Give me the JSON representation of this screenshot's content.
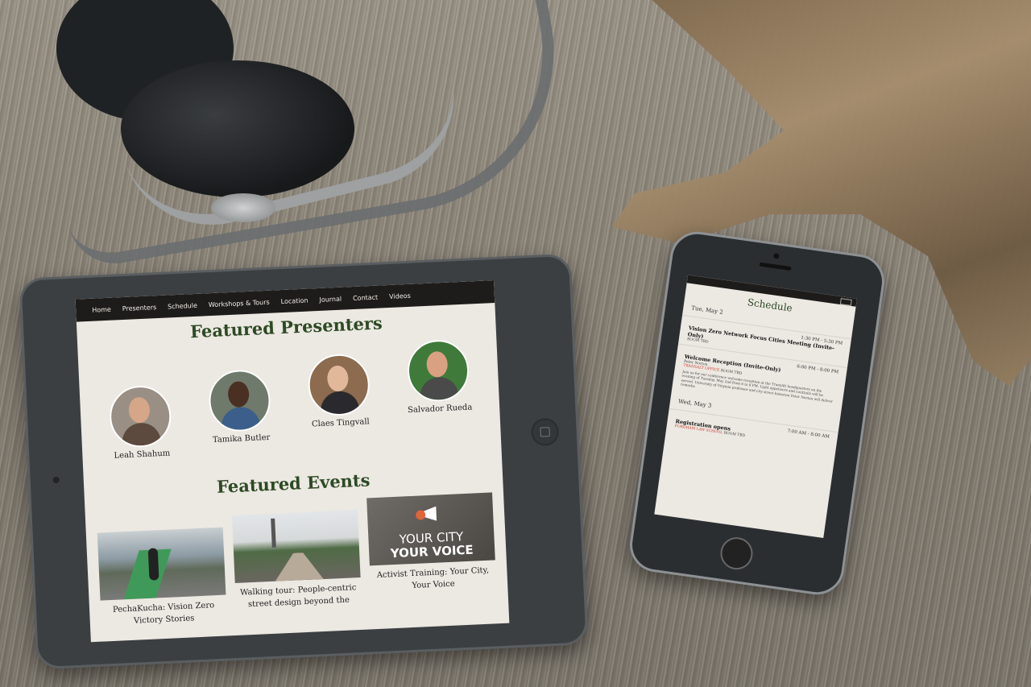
{
  "tablet": {
    "nav": [
      "Home",
      "Presenters",
      "Schedule",
      "Workshops & Tours",
      "Location",
      "Journal",
      "Contact",
      "Videos"
    ],
    "presenters_heading": "Featured Presenters",
    "presenters": [
      {
        "name": "Leah Shahum"
      },
      {
        "name": "Tamika Butler"
      },
      {
        "name": "Claes Tingvall"
      },
      {
        "name": "Salvador Rueda"
      }
    ],
    "events_heading": "Featured Events",
    "events": [
      {
        "title": "PechaKucha: Vision Zero Victory Stories"
      },
      {
        "title": "Walking tour: People-centric street design beyond the"
      },
      {
        "title": "Activist Training: Your City, Your Voice",
        "image_text_1": "YOUR CITY",
        "image_text_2": "YOUR VOICE"
      }
    ]
  },
  "phone": {
    "title": "Schedule",
    "days": [
      {
        "label": "Tue, May 2",
        "items": [
          {
            "time": "1:30 PM - 5:30 PM",
            "title": "Vision Zero Network Focus Cities Meeting (Invite-Only)",
            "room": "ROOM TBD"
          },
          {
            "time": "6:00 PM - 8:00 PM",
            "title": "Welcome Reception (Invite-Only)",
            "organizer": "Peter Norton",
            "venue": "TRANSALT OFFICE",
            "room": "ROOM TBD",
            "desc": "Join us for our conference welcome reception at the TransAlt headquarters on the evening of Tuesday, May 2nd from 6 to 8 PM. Light appetizers and cocktails will be served. University of Virginia professor and city street historian Peter Norton will deliver remarks."
          }
        ]
      },
      {
        "label": "Wed, May 3",
        "items": [
          {
            "time": "7:00 AM - 8:00 AM",
            "title": "Registration opens",
            "venue": "FORDHAM LAW SCHOOL",
            "room": "ROOM TBD"
          }
        ]
      }
    ]
  },
  "colors": {
    "heading_green": "#2d4a24",
    "nav_bg": "#1e1c1a",
    "screen_bg": "#ece8e2",
    "accent_red": "#c43a2a"
  }
}
